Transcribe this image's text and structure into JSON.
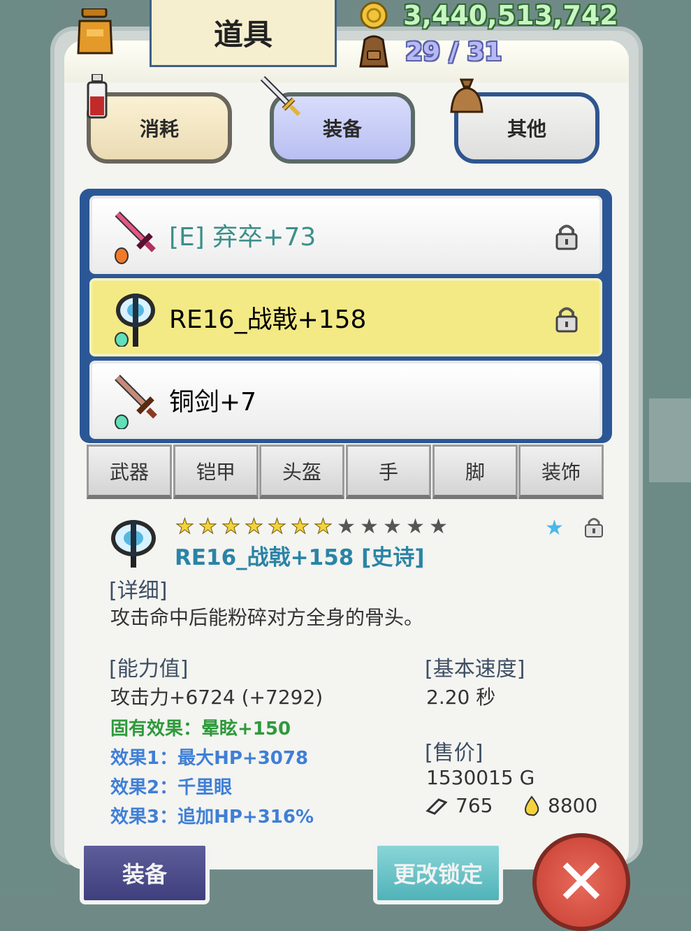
{
  "header": {
    "title": "道具",
    "gold": "3,440,513,742",
    "capacity": "29 / 31"
  },
  "categories": [
    {
      "label": "消耗",
      "icon": "potion-icon",
      "selected": false
    },
    {
      "label": "装备",
      "icon": "sword-icon",
      "selected": true
    },
    {
      "label": "其他",
      "icon": "sack-icon",
      "selected": false
    }
  ],
  "items": [
    {
      "name": "[E] 弃卒+73",
      "icon": "pink-sword-icon",
      "locked": true,
      "equipped": true,
      "text_color": "#3b8f8a"
    },
    {
      "name": "RE16_战戟+158",
      "icon": "halberd-icon",
      "locked": true,
      "selected": true,
      "text_color": "#333333"
    },
    {
      "name": "铜剑+7",
      "icon": "bronze-sword-icon",
      "locked": false,
      "text_color": "#333333"
    }
  ],
  "slot_tabs": [
    "武器",
    "铠甲",
    "头盔",
    "手",
    "脚",
    "装饰"
  ],
  "detail": {
    "stars_filled": 7,
    "stars_total": 12,
    "name": "RE16_战戟+158 [史诗]",
    "detail_header": "[详细]",
    "description": "攻击命中后能粉碎对方全身的骨头。",
    "stats_header": "[能力值]",
    "attack": "攻击力+6724 (+7292)",
    "inherent_effect": "固有效果：晕眩+150",
    "effect1": "效果1：最大HP+3078",
    "effect2": "效果2：千里眼",
    "effect3": "效果3：追加HP+316%",
    "speed_header": "[基本速度]",
    "speed": "2.20 秒",
    "price_header": "[售价]",
    "price": "1530015 G",
    "material1": "765",
    "material2": "8800"
  },
  "buttons": {
    "equip": "装备",
    "change_lock": "更改锁定"
  },
  "colors": {
    "selected_row": "#f3ea86",
    "list_frame": "#2b5796",
    "epic_name": "#2a84a6",
    "inherent_green": "#2e9a3c",
    "effect_blue": "#3f7fd6"
  }
}
